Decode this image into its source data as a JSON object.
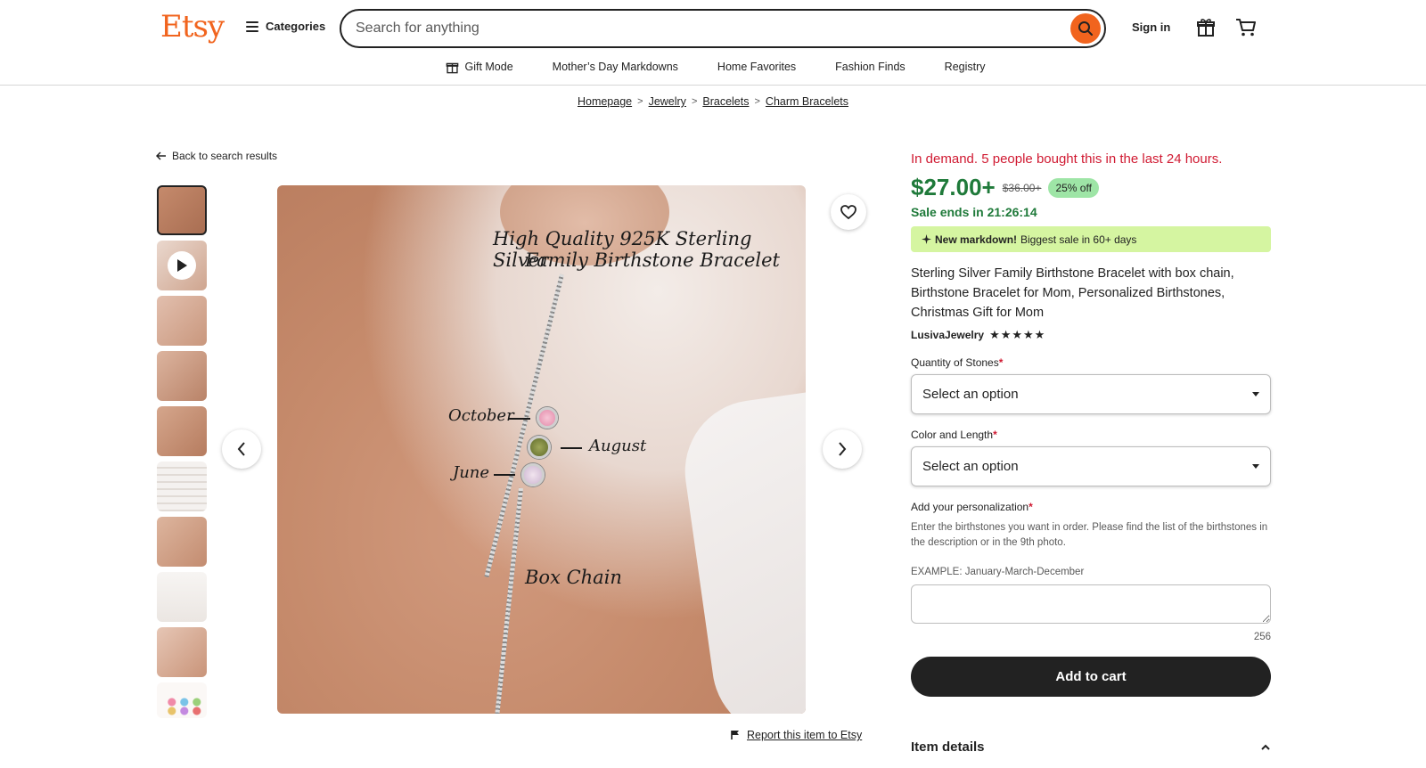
{
  "header": {
    "logo": "Etsy",
    "categories_label": "Categories",
    "search_placeholder": "Search for anything",
    "signin_label": "Sign in"
  },
  "subnav": {
    "items": [
      "Gift Mode",
      "Mother’s Day Markdowns",
      "Home Favorites",
      "Fashion Finds",
      "Registry"
    ]
  },
  "breadcrumb": [
    "Homepage",
    "Jewelry",
    "Bracelets",
    "Charm Bracelets"
  ],
  "back_label": "Back to search results",
  "image": {
    "title_line1": "High Quality 925K Sterling Silver",
    "title_line2": "Family Birthstone Bracelet",
    "label_october": "October",
    "label_august": "August",
    "label_june": "June",
    "label_chain": "Box Chain"
  },
  "report_label": "Report this item to Etsy",
  "product": {
    "demand": "In demand. 5 people bought this in the last 24 hours.",
    "price": "$27.00+",
    "original_price": "$36.00+",
    "discount": "25% off",
    "sale_ends": "Sale ends in 21:26:14",
    "markdown_bold": "New markdown!",
    "markdown_text": "Biggest sale in 60+ days",
    "title": "Sterling Silver Family Birthstone Bracelet with box chain, Birthstone Bracelet for Mom, Personalized Birthstones, Christmas Gift for Mom",
    "shop": "LusivaJewelry",
    "rating_stars": "★★★★★",
    "rating": 5
  },
  "options": {
    "quantity_label": "Quantity of Stones",
    "quantity_value": "Select an option",
    "color_label": "Color and Length",
    "color_value": "Select an option",
    "required_mark": "*"
  },
  "personalization": {
    "label": "Add your personalization",
    "help": "Enter the birthstones you want in order. Please find the list of the birthstones in the description or in the 9th photo.",
    "example": "EXAMPLE: January-March-December",
    "value": "",
    "counter": "256"
  },
  "add_to_cart": "Add to cart",
  "item_details": "Item details",
  "colors": {
    "brand": "#f1641e",
    "demand": "#d01a32",
    "price": "#1f7a3a",
    "markdown_bg": "#d5f5a1",
    "discount_bg": "#9ee5a6"
  }
}
